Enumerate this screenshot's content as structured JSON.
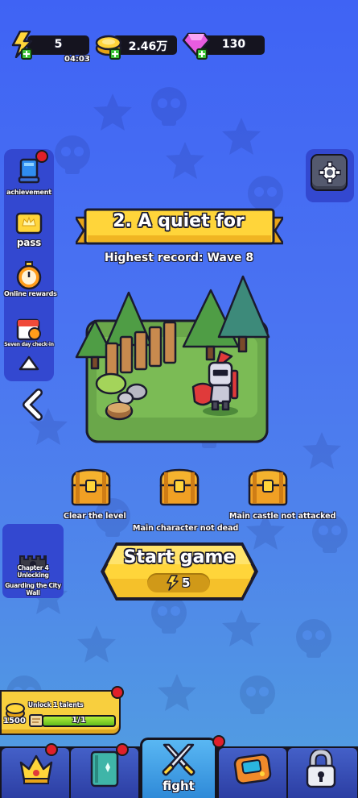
{
  "resources": {
    "energy": {
      "value": "5",
      "timer": "04:03",
      "icon": "lightning-icon"
    },
    "gold": {
      "value": "2.46万",
      "icon": "gold-coin-icon"
    },
    "gems": {
      "value": "130",
      "icon": "diamond-icon"
    }
  },
  "sidebar": {
    "items": [
      {
        "label": "achievement",
        "icon": "trophy-icon",
        "badge": true
      },
      {
        "label": "pass",
        "icon": "pass-ticket-icon",
        "badge": false
      },
      {
        "label": "Online rewards",
        "icon": "stopwatch-icon",
        "badge": false
      },
      {
        "label": "Seven day check-in",
        "icon": "calendar-icon",
        "badge": false
      }
    ],
    "collapse_icon": "chevron-up-icon"
  },
  "back_icon": "chevron-left-icon",
  "settings_icon": "gear-icon",
  "level": {
    "title": "2. A quiet for",
    "record": "Highest record: Wave 8"
  },
  "objectives": [
    {
      "label": "Clear the level",
      "icon": "treasure-chest-icon"
    },
    {
      "label": "Main character not dead",
      "icon": "treasure-chest-icon"
    },
    {
      "label": "Main castle not attacked",
      "icon": "treasure-chest-icon"
    }
  ],
  "chapter": {
    "line1": "Chapter 4 Unlocking",
    "line2": "Guarding the City Wall"
  },
  "start": {
    "label": "Start game",
    "cost": "5"
  },
  "talent": {
    "text": "Unlock 1 talents",
    "coins": "1500",
    "progress_text": "1/1",
    "progress": 1.0
  },
  "nav": {
    "active_label": "fight",
    "tabs": [
      {
        "icon": "crown-icon",
        "badge": true
      },
      {
        "icon": "spellbook-icon",
        "badge": true
      },
      {
        "icon": "crossed-swords-icon",
        "badge": true
      },
      {
        "icon": "game-console-icon",
        "badge": false
      },
      {
        "icon": "padlock-icon",
        "badge": false
      }
    ]
  },
  "colors": {
    "background_top": "#3f63f4",
    "background_bottom": "#52a0e0",
    "panel": "#3348d0",
    "gold": "#f8cf3e",
    "badge_red": "#e0202a",
    "progress_green": "#6fcf2a"
  }
}
